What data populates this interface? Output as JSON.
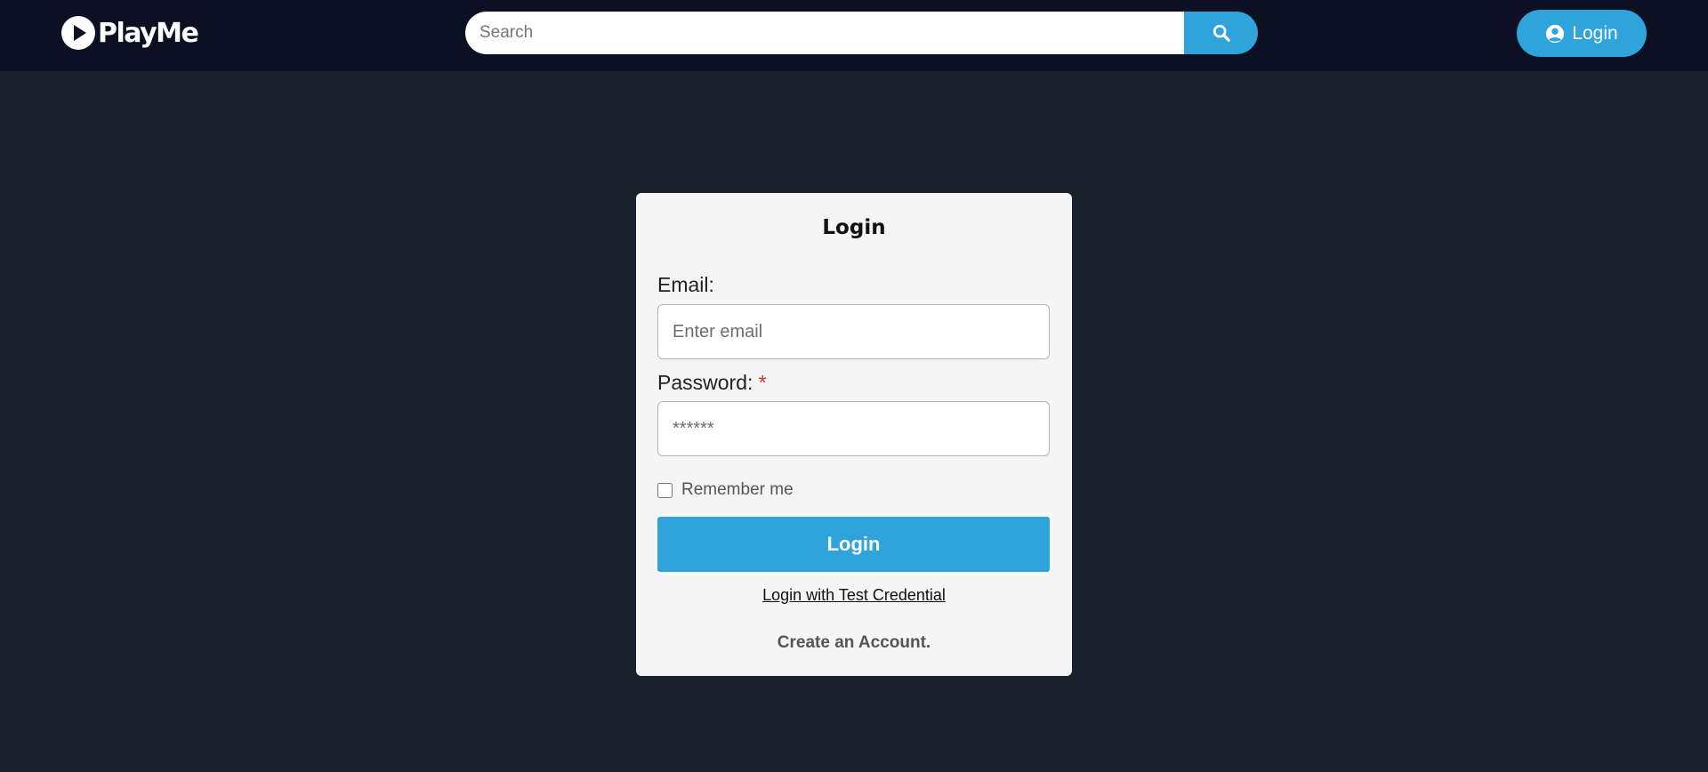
{
  "header": {
    "brand": "PlayMe",
    "search_placeholder": "Search",
    "login_label": "Login"
  },
  "login_form": {
    "title": "Login",
    "email_label": "Email:",
    "email_placeholder": "Enter email",
    "password_label": "Password:",
    "required_marker": "*",
    "password_placeholder": "******",
    "remember_label": "Remember me",
    "remember_checked": false,
    "submit_label": "Login",
    "test_credential_label": "Login with Test Credential",
    "create_account_label": "Create an Account."
  },
  "colors": {
    "header_bg": "#0b1123",
    "page_bg": "#1b202d",
    "accent": "#2ea3dc",
    "card_bg": "#f5f5f5",
    "required": "#d0312d"
  },
  "icons": {
    "logo": "play-circle-icon",
    "search": "search-icon",
    "user": "user-circle-icon"
  }
}
